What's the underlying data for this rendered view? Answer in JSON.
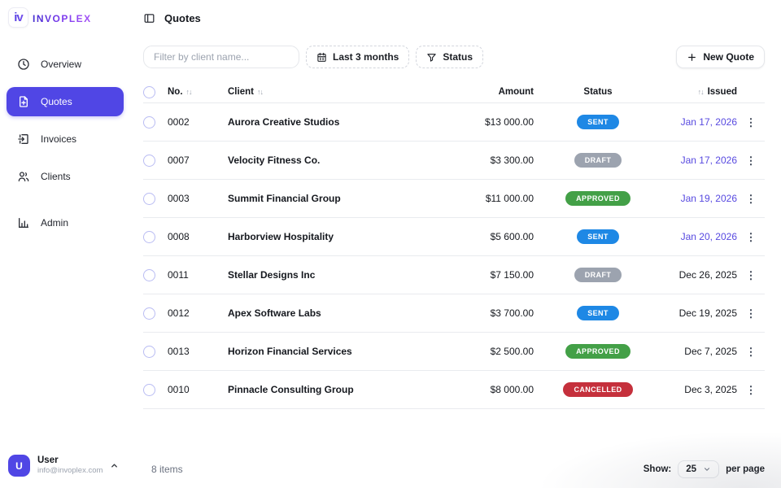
{
  "brand": {
    "mark": "iv",
    "name": "invoplex",
    "accent_color": "#5046e5"
  },
  "topbar": {
    "title": "Quotes",
    "icon": "panel-left-icon"
  },
  "sidebar": {
    "items": [
      {
        "label": "Overview",
        "icon": "clock-icon",
        "active": false
      },
      {
        "label": "Quotes",
        "icon": "file-plus-icon",
        "active": true
      },
      {
        "label": "Invoices",
        "icon": "file-export-icon",
        "active": false
      },
      {
        "label": "Clients",
        "icon": "users-icon",
        "active": false
      },
      {
        "label": "Admin",
        "icon": "bar-chart-icon",
        "active": false
      }
    ],
    "user": {
      "initial": "U",
      "name": "User",
      "email": "info@invoplex.com",
      "chevron": "chevron-up-icon"
    }
  },
  "toolbar": {
    "filter_placeholder": "Filter by client name...",
    "date_filter_label": "Last 3 months",
    "date_filter_icon": "calendar-icon",
    "status_filter_label": "Status",
    "status_filter_icon": "funnel-icon",
    "new_quote_label": "New Quote",
    "new_quote_icon": "plus-icon"
  },
  "table": {
    "headers": {
      "no": "No.",
      "client": "Client",
      "amount": "Amount",
      "status": "Status",
      "issued": "Issued"
    },
    "sort_glyph": "↑↓",
    "status_colors": {
      "sent": "#1e88e5",
      "draft": "#9ca3af",
      "approved": "#43a047",
      "cancelled": "#c5303c"
    },
    "issued_colors": {
      "upcoming": "#5749e0",
      "past": "#15181e"
    },
    "rows": [
      {
        "no": "0002",
        "client": "Aurora Creative Studios",
        "amount": "$13 000.00",
        "status": "SENT",
        "status_color": "#1e88e5",
        "issued": "Jan 17, 2026",
        "issued_color": "#5749e0"
      },
      {
        "no": "0007",
        "client": "Velocity Fitness Co.",
        "amount": "$3 300.00",
        "status": "DRAFT",
        "status_color": "#9ca3af",
        "issued": "Jan 17, 2026",
        "issued_color": "#5749e0"
      },
      {
        "no": "0003",
        "client": "Summit Financial Group",
        "amount": "$11 000.00",
        "status": "APPROVED",
        "status_color": "#43a047",
        "issued": "Jan 19, 2026",
        "issued_color": "#5749e0"
      },
      {
        "no": "0008",
        "client": "Harborview Hospitality",
        "amount": "$5 600.00",
        "status": "SENT",
        "status_color": "#1e88e5",
        "issued": "Jan 20, 2026",
        "issued_color": "#5749e0"
      },
      {
        "no": "0011",
        "client": "Stellar Designs Inc",
        "amount": "$7 150.00",
        "status": "DRAFT",
        "status_color": "#9ca3af",
        "issued": "Dec 26, 2025",
        "issued_color": "#15181e"
      },
      {
        "no": "0012",
        "client": "Apex Software Labs",
        "amount": "$3 700.00",
        "status": "SENT",
        "status_color": "#1e88e5",
        "issued": "Dec 19, 2025",
        "issued_color": "#15181e"
      },
      {
        "no": "0013",
        "client": "Horizon Financial Services",
        "amount": "$2 500.00",
        "status": "APPROVED",
        "status_color": "#43a047",
        "issued": "Dec 7, 2025",
        "issued_color": "#15181e"
      },
      {
        "no": "0010",
        "client": "Pinnacle Consulting Group",
        "amount": "$8 000.00",
        "status": "CANCELLED",
        "status_color": "#c5303c",
        "issued": "Dec 3, 2025",
        "issued_color": "#15181e"
      }
    ]
  },
  "footer": {
    "items_count": "8 items",
    "show_label": "Show:",
    "page_size": "25",
    "per_page_label": "per page"
  }
}
